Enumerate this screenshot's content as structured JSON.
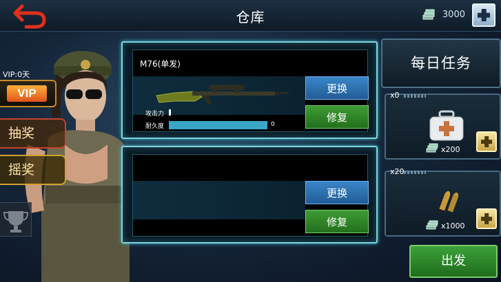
{
  "header": {
    "title": "仓库",
    "currency_amount": "3000",
    "currency_icon": "cash-stack-icon"
  },
  "sidebar": {
    "vip_status": "VIP:0天",
    "vip_label": "VIP",
    "lottery_label": "抽奖",
    "shake_label": "摇奖",
    "trophy_icon": "trophy-icon"
  },
  "slots": [
    {
      "weapon_name": "M76(单发)",
      "replace_label": "更换",
      "repair_label": "修复",
      "stats": {
        "attack_label": "攻击力",
        "durability_label": "耐久度",
        "durability_value": "0"
      }
    },
    {
      "weapon_name": "",
      "replace_label": "更换",
      "repair_label": "修复"
    }
  ],
  "right_panel": {
    "daily_task_label": "每日任务",
    "items": [
      {
        "count": "x0",
        "price": "x200",
        "icon": "medkit-icon"
      },
      {
        "count": "x20",
        "price": "x1000",
        "icon": "ammo-icon"
      }
    ],
    "go_label": "出发"
  },
  "colors": {
    "accent_cyan": "#7fd4df",
    "replace_blue": "#2f74b4",
    "repair_green": "#2f8a28",
    "vip_orange": "#e0531a"
  }
}
